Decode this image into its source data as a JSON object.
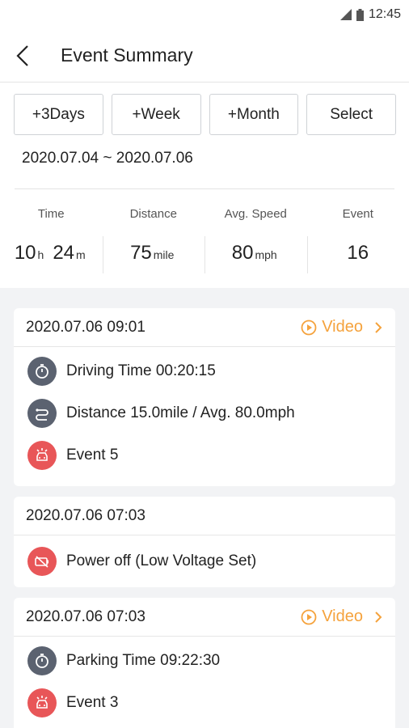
{
  "status": {
    "time": "12:45",
    "signal_icon": "signal-icon",
    "battery_icon": "battery-icon"
  },
  "header": {
    "title": "Event Summary"
  },
  "filters": {
    "three_days": "+3Days",
    "week": "+Week",
    "month": "+Month",
    "select": "Select"
  },
  "range": "2020.07.04 ~ 2020.07.06",
  "stats": {
    "time": {
      "label": "Time",
      "hours": "10",
      "h_unit": "h",
      "minutes": "24",
      "m_unit": "m"
    },
    "distance": {
      "label": "Distance",
      "value": "75",
      "unit": "mile"
    },
    "speed": {
      "label": "Avg. Speed",
      "value": "80",
      "unit": "mph"
    },
    "event": {
      "label": "Event",
      "value": "16"
    }
  },
  "colors": {
    "accent": "#f5a23c",
    "icon_gray": "#5b6270",
    "icon_red": "#e85658"
  },
  "cards": [
    {
      "date": "2020.07.06 09:01",
      "video": "Video",
      "rows": [
        {
          "icon": "stopwatch-icon",
          "text": "Driving Time  00:20:15"
        },
        {
          "icon": "route-icon",
          "text": "Distance 15.0mile / Avg. 80.0mph"
        },
        {
          "icon": "car-crash-icon",
          "text": "Event  5"
        }
      ]
    },
    {
      "date": "2020.07.06 07:03",
      "rows": [
        {
          "icon": "battery-low-icon",
          "text": "Power off (Low Voltage Set)"
        }
      ]
    },
    {
      "date": "2020.07.06 07:03",
      "video": "Video",
      "rows": [
        {
          "icon": "stopwatch-icon",
          "text": "Parking Time  09:22:30"
        },
        {
          "icon": "car-crash-icon",
          "text": "Event  3"
        }
      ]
    }
  ]
}
